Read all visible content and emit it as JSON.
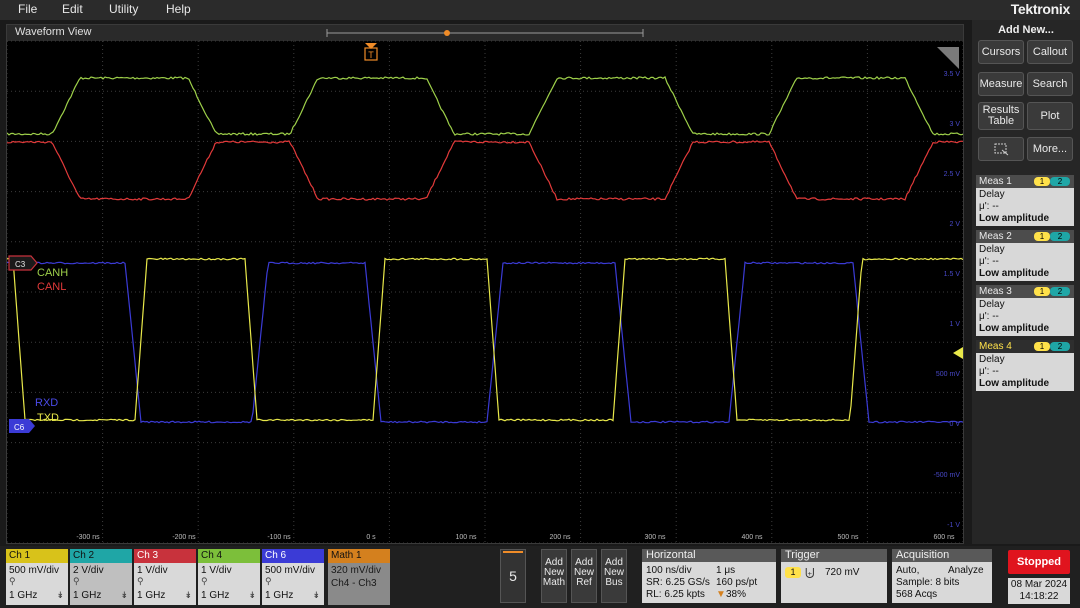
{
  "menu": {
    "file": "File",
    "edit": "Edit",
    "utility": "Utility",
    "help": "Help",
    "brand": "Tektronix"
  },
  "waveform": {
    "title": "Waveform View",
    "labels": {
      "canh": "CANH",
      "canl": "CANL",
      "rxd": "RXD",
      "txd": "TXD"
    },
    "markers": {
      "c3": "C3",
      "c6": "C6",
      "trigger": "T"
    },
    "x_ticks": [
      "-300 ns",
      "-200 ns",
      "-100 ns",
      "0 s",
      "100 ns",
      "200 ns",
      "300 ns",
      "400 ns",
      "500 ns",
      "600 ns"
    ],
    "y_ticks_right": [
      "3.5 V",
      "3 V",
      "2.5 V",
      "2 V",
      "1.5 V",
      "1 V",
      "500 mV",
      "0 V",
      "-500 mV",
      "-1 V"
    ],
    "colors": {
      "canh": "#9ed04a",
      "canl": "#e23a3a",
      "rxd": "#3b3bd6",
      "txd": "#e8e84a",
      "grid": "#3c3c3c",
      "trigger": "#f08c28"
    }
  },
  "right_panel": {
    "add_new": "Add New...",
    "buttons": {
      "cursors": "Cursors",
      "callout": "Callout",
      "measure": "Measure",
      "search": "Search",
      "results_table_1": "Results",
      "results_table_2": "Table",
      "plot": "Plot",
      "more": "More..."
    },
    "measurements": [
      {
        "title": "Meas 1",
        "type": "Delay",
        "value": "μ': --",
        "status": "Low amplitude",
        "src1": "1",
        "src2": "2"
      },
      {
        "title": "Meas 2",
        "type": "Delay",
        "value": "μ': --",
        "status": "Low amplitude",
        "src1": "1",
        "src2": "2"
      },
      {
        "title": "Meas 3",
        "type": "Delay",
        "value": "μ': --",
        "status": "Low amplitude",
        "src1": "1",
        "src2": "2"
      },
      {
        "title": "Meas 4",
        "type": "Delay",
        "value": "μ': --",
        "status": "Low amplitude",
        "src1": "1",
        "src2": "2"
      }
    ]
  },
  "channels": [
    {
      "title": "Ch 1",
      "scale": "500 mV/div",
      "bw": "1 GHz",
      "color": "#d8c21a"
    },
    {
      "title": "Ch 2",
      "scale": "2 V/div",
      "bw": "1 GHz",
      "color": "#1fa6a6"
    },
    {
      "title": "Ch 3",
      "scale": "1 V/div",
      "bw": "1 GHz",
      "color": "#c8323c"
    },
    {
      "title": "Ch 4",
      "scale": "1 V/div",
      "bw": "1 GHz",
      "color": "#7cbf3a"
    },
    {
      "title": "Ch 6",
      "scale": "500 mV/div",
      "bw": "1 GHz",
      "color": "#3b3bd6"
    }
  ],
  "math": {
    "title": "Math 1",
    "scale": "320 mV/div",
    "expr": "Ch4 - Ch3",
    "color": "#d4801e"
  },
  "bottom": {
    "wave_count": "5",
    "add_math": [
      "Add",
      "New",
      "Math"
    ],
    "add_ref": [
      "Add",
      "New",
      "Ref"
    ],
    "add_bus": [
      "Add",
      "New",
      "Bus"
    ],
    "horizontal": {
      "title": "Horizontal",
      "l1a": "100 ns/div",
      "l1b": "1 μs",
      "l2a": "SR: 6.25 GS/s",
      "l2b": "160 ps/pt",
      "l3a": "RL: 6.25 kpts",
      "l3b": "38%"
    },
    "trigger": {
      "title": "Trigger",
      "src": "1",
      "level": "720 mV"
    },
    "acquisition": {
      "title": "Acquisition",
      "l1a": "Auto,",
      "l1b": "Analyze",
      "l2": "Sample: 8 bits",
      "l3": "568 Acqs"
    },
    "run_state": "Stopped",
    "date": "08 Mar 2024",
    "time": "14:18:22"
  }
}
